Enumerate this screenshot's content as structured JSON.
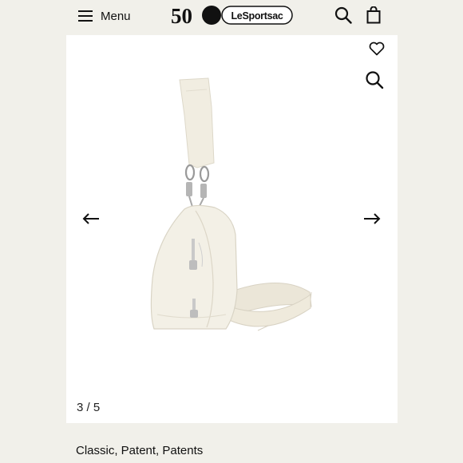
{
  "header": {
    "menu_label": "Menu",
    "logo": {
      "badge_text": "50",
      "brand_text": "LeSportsac"
    },
    "icons": [
      "hamburger-icon",
      "search-icon",
      "shopping-bag-icon"
    ]
  },
  "gallery": {
    "icons": [
      "heart-icon",
      "zoom-icon",
      "arrow-left-icon",
      "arrow-right-icon"
    ],
    "counter": "3 / 5",
    "current_index": 3,
    "total": 5
  },
  "product": {
    "description": "Classic, Patent, Patents"
  },
  "colors": {
    "page_background": "#f1f0ea",
    "gallery_background": "#ffffff",
    "bag_color": "#f1ede1"
  }
}
